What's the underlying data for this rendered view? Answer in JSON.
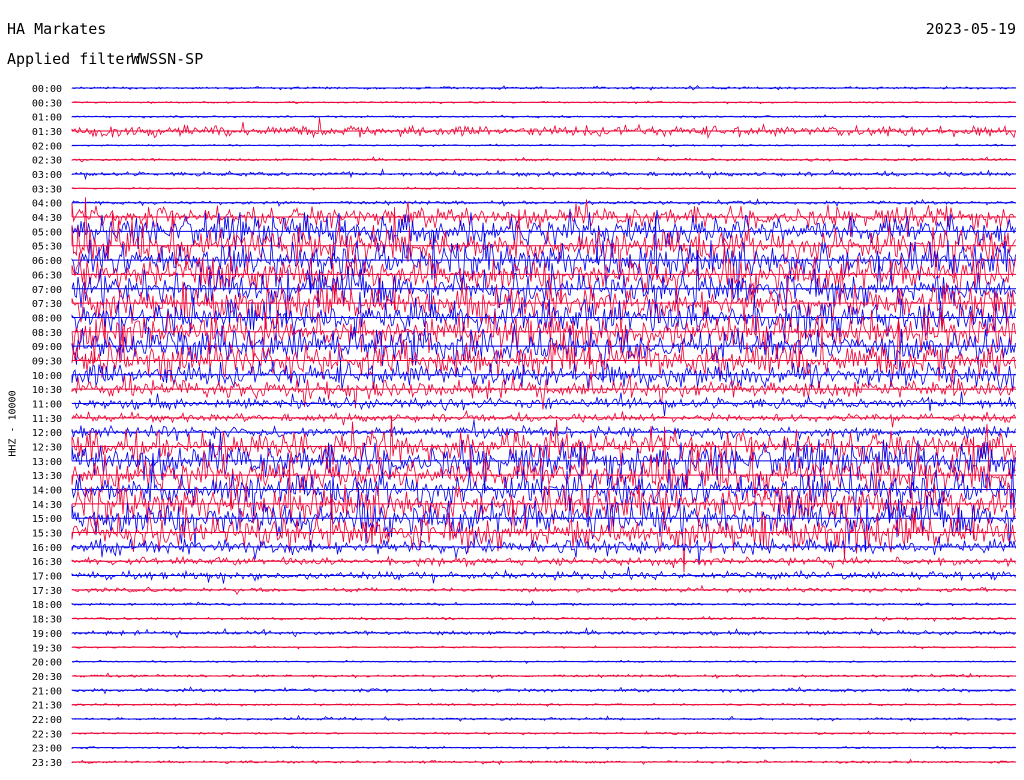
{
  "header": {
    "station": "HA Markates",
    "filter_label": "Applied filter:",
    "filter_value": "WWSSN-SP",
    "date": "2023-05-19"
  },
  "chart_data": {
    "type": "line",
    "title": "HA Markates",
    "ylabel": "HHZ - 10000",
    "filter": "WWSSN-SP",
    "date": "2023-05-19",
    "colors": {
      "blue": "#0000ee",
      "red": "#ee0033"
    },
    "row_labels": [
      "00:00",
      "00:30",
      "01:00",
      "01:30",
      "02:00",
      "02:30",
      "03:00",
      "03:30",
      "04:00",
      "04:30",
      "05:00",
      "05:30",
      "06:00",
      "06:30",
      "07:00",
      "07:30",
      "08:00",
      "08:30",
      "09:00",
      "09:30",
      "10:00",
      "10:30",
      "11:00",
      "11:30",
      "12:00",
      "12:30",
      "13:00",
      "13:30",
      "14:00",
      "14:30",
      "15:00",
      "15:30",
      "16:00",
      "16:30",
      "17:00",
      "17:30",
      "18:00",
      "18:30",
      "19:00",
      "19:30",
      "20:00",
      "20:30",
      "21:00",
      "21:30",
      "22:00",
      "22:30",
      "23:00",
      "23:30"
    ],
    "row_colors": [
      "blue",
      "red",
      "blue",
      "red",
      "blue",
      "red",
      "blue",
      "red",
      "blue",
      "red",
      "blue",
      "red",
      "blue",
      "red",
      "blue",
      "red",
      "blue",
      "red",
      "blue",
      "red",
      "blue",
      "red",
      "blue",
      "red",
      "blue",
      "red",
      "blue",
      "red",
      "blue",
      "red",
      "blue",
      "red",
      "blue",
      "red",
      "blue",
      "red",
      "blue",
      "red",
      "blue",
      "red",
      "blue",
      "red",
      "blue",
      "red",
      "blue",
      "red",
      "blue",
      "red"
    ],
    "activity_level": [
      0.05,
      0.02,
      0.03,
      0.3,
      0.02,
      0.05,
      0.1,
      0.02,
      0.08,
      0.6,
      0.9,
      1.0,
      1.0,
      1.0,
      1.0,
      1.0,
      1.0,
      1.0,
      1.0,
      1.0,
      0.7,
      0.5,
      0.3,
      0.2,
      0.3,
      0.9,
      1.0,
      1.0,
      1.0,
      1.0,
      1.0,
      1.0,
      0.4,
      0.2,
      0.2,
      0.1,
      0.05,
      0.05,
      0.1,
      0.02,
      0.02,
      0.05,
      0.08,
      0.03,
      0.05,
      0.03,
      0.03,
      0.05
    ]
  }
}
